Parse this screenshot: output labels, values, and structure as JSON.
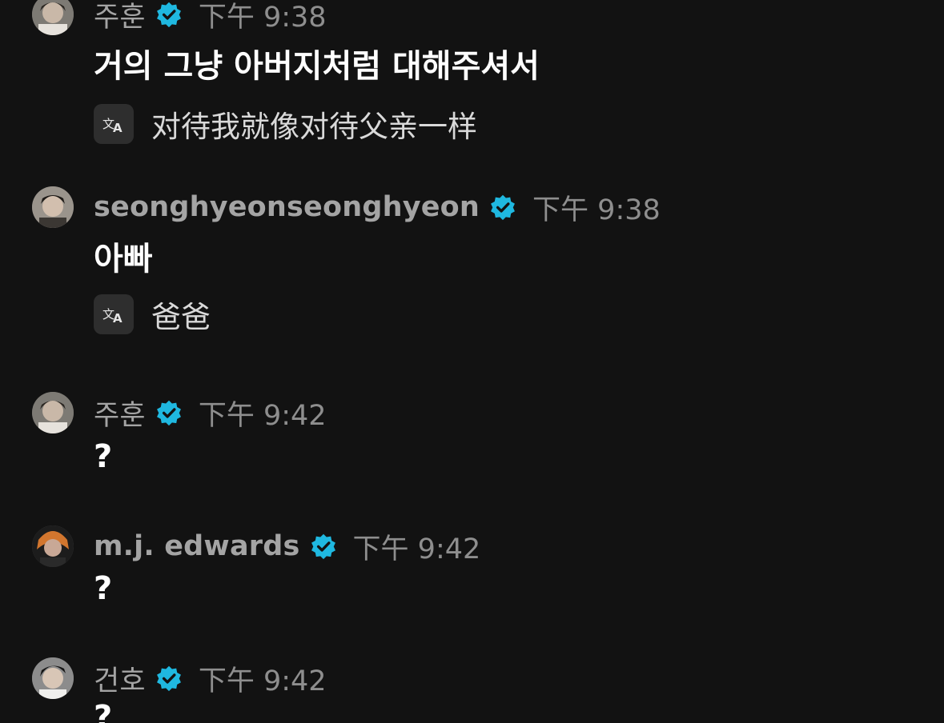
{
  "messages": [
    {
      "username": "주훈",
      "time": "下午 9:38",
      "text": "거의 그냥 아버지처럼 대해주셔서",
      "translation": "对待我就像对待父亲一样"
    },
    {
      "username": "seonghyeonseonghyeon",
      "time": "下午 9:38",
      "text": "아빠",
      "translation": "爸爸"
    },
    {
      "username": "주훈",
      "time": "下午 9:42",
      "text": "?"
    },
    {
      "username": "m.j. edwards",
      "time": "下午 9:42",
      "text": "?"
    },
    {
      "username": "건호",
      "time": "下午 9:42",
      "text": "?"
    }
  ],
  "icons": {
    "verified": "verified-badge-icon",
    "translate": "translate-icon"
  },
  "colors": {
    "background": "#121212",
    "verified": "#1fb8e0",
    "username": "#a4a4a4",
    "time": "#8e8e8e"
  }
}
